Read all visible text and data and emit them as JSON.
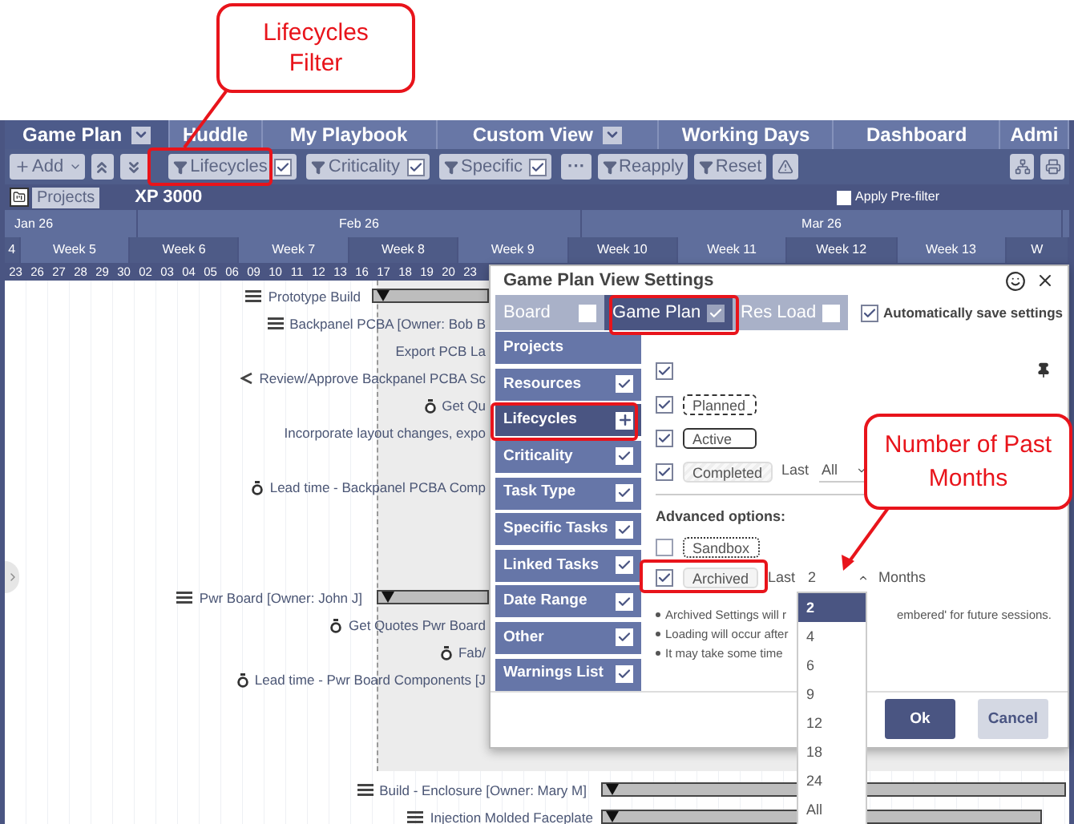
{
  "annotations": [
    {
      "text": "Lifecycles Filter"
    },
    {
      "text": "Number of Past Months"
    }
  ],
  "nav_tabs": [
    {
      "label": "Game Plan",
      "has_menu": true,
      "selected": true
    },
    {
      "label": "Huddle",
      "has_menu": false,
      "selected": false
    },
    {
      "label": "My Playbook",
      "has_menu": false,
      "selected": false
    },
    {
      "label": "Custom View",
      "has_menu": true,
      "selected": false
    },
    {
      "label": "Working Days",
      "has_menu": false,
      "selected": false
    },
    {
      "label": "Dashboard",
      "has_menu": false,
      "selected": false
    },
    {
      "label": "Admi",
      "has_menu": false,
      "selected": false
    }
  ],
  "toolbar": {
    "add": "Add",
    "filters": [
      {
        "label": "Lifecycles",
        "checked": true
      },
      {
        "label": "Criticality",
        "checked": true
      },
      {
        "label": "Specific",
        "checked": true
      }
    ],
    "more": "···",
    "actions": [
      {
        "label": "Reapply"
      },
      {
        "label": "Reset"
      }
    ]
  },
  "project_bar": {
    "button": "Projects",
    "project": "XP 3000",
    "prefilter": {
      "label": "Apply Pre-filter",
      "checked": false
    }
  },
  "timeline": {
    "months": [
      "Jan 26",
      "Feb 26",
      "Mar 26"
    ],
    "weeks": [
      "4",
      "Week 5",
      "Week 6",
      "Week 7",
      "Week 8",
      "Week 9",
      "Week 10",
      "Week 11",
      "Week 12",
      "Week 13",
      "W"
    ],
    "days": [
      "23",
      "26",
      "27",
      "28",
      "29",
      "30",
      "02",
      "03",
      "04",
      "05",
      "06",
      "09",
      "10",
      "11",
      "12",
      "13",
      "16",
      "17",
      "18",
      "19",
      "20",
      "23"
    ]
  },
  "tasks": [
    {
      "text": "Prototype Build",
      "kind": "summary"
    },
    {
      "text": "Backpanel PCBA [Owner: Bob B",
      "kind": "summary"
    },
    {
      "text": "Export PCB La",
      "kind": "plain"
    },
    {
      "text": "Review/Approve Backpanel PCBA Sc",
      "kind": "link"
    },
    {
      "text": "Get Qu",
      "kind": "timer"
    },
    {
      "text": "Incorporate layout changes, expo",
      "kind": "plain"
    },
    {
      "text": "Lead time - Backpanel PCBA Comp",
      "kind": "timer"
    },
    {
      "text": "Pwr Board [Owner: John J]",
      "kind": "summary"
    },
    {
      "text": "Get Quotes Pwr Board",
      "kind": "timer"
    },
    {
      "text": "Fab/",
      "kind": "timer"
    },
    {
      "text": "Lead time - Pwr Board Components [J",
      "kind": "timer"
    },
    {
      "text": "Build - Enclosure [Owner: Mary M]",
      "kind": "summary"
    },
    {
      "text": "Injection Molded Faceplate",
      "kind": "summary"
    }
  ],
  "dialog": {
    "title": "Game Plan View Settings",
    "views": [
      {
        "label": "Board",
        "checked": false,
        "selected": false
      },
      {
        "label": "Game Plan",
        "checked": true,
        "selected": true
      },
      {
        "label": "Res Load",
        "checked": false,
        "selected": false
      }
    ],
    "autosave": {
      "label": "Automatically save settings",
      "checked": true
    },
    "sections": [
      {
        "label": "Projects",
        "kind": "plain",
        "selected": false
      },
      {
        "label": "Resources",
        "kind": "check",
        "checked": true,
        "selected": false
      },
      {
        "label": "Lifecycles",
        "kind": "expand",
        "selected": true
      },
      {
        "label": "Criticality",
        "kind": "check",
        "checked": true,
        "selected": false
      },
      {
        "label": "Task Type",
        "kind": "check",
        "checked": true,
        "selected": false
      },
      {
        "label": "Specific Tasks",
        "kind": "check",
        "checked": true,
        "selected": false
      },
      {
        "label": "Linked Tasks",
        "kind": "check",
        "checked": true,
        "selected": false
      },
      {
        "label": "Date Range",
        "kind": "check",
        "checked": true,
        "selected": false
      },
      {
        "label": "Other",
        "kind": "check",
        "checked": true,
        "selected": false
      },
      {
        "label": "Warnings List",
        "kind": "check",
        "checked": true,
        "selected": false
      }
    ],
    "all_checked": true,
    "states": [
      {
        "label": "Planned",
        "kind": "dashed",
        "checked": true
      },
      {
        "label": "Active",
        "kind": "solid",
        "checked": true
      },
      {
        "label": "Completed",
        "kind": "hatched",
        "checked": true,
        "last_label": "Last",
        "last_value": "All"
      }
    ],
    "advanced_title": "Advanced options:",
    "advanced": [
      {
        "label": "Sandbox",
        "kind": "dotted",
        "checked": false
      },
      {
        "label": "Archived",
        "kind": "plain",
        "checked": true,
        "last_label": "Last",
        "last_value": "2",
        "unit": "Months"
      }
    ],
    "notes": [
      {
        "before": "Archived Settings will r",
        "after": "embered' for future sessions."
      },
      {
        "before": "Loading will occur after"
      },
      {
        "before": "It may take some time"
      }
    ],
    "ok": "Ok",
    "cancel": "Cancel",
    "months_options": [
      {
        "label": "2",
        "selected": true
      },
      {
        "label": "4",
        "selected": false
      },
      {
        "label": "6",
        "selected": false
      },
      {
        "label": "9",
        "selected": false
      },
      {
        "label": "12",
        "selected": false
      },
      {
        "label": "18",
        "selected": false
      },
      {
        "label": "24",
        "selected": false
      },
      {
        "label": "All",
        "selected": false
      }
    ]
  }
}
